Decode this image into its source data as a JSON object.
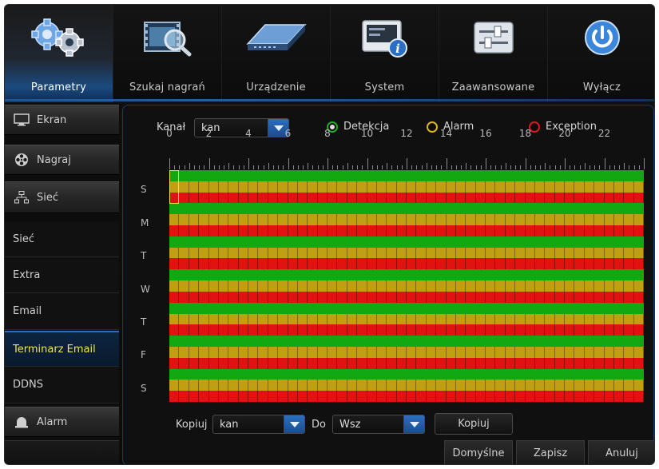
{
  "nav": {
    "items": [
      {
        "label": "Parametry",
        "icon": "gears-icon",
        "active": true
      },
      {
        "label": "Szukaj nagrań",
        "icon": "film-search-icon",
        "active": false
      },
      {
        "label": "Urządzenie",
        "icon": "hard-drive-icon",
        "active": false
      },
      {
        "label": "System",
        "icon": "system-info-icon",
        "active": false
      },
      {
        "label": "Zaawansowane",
        "icon": "sliders-icon",
        "active": false
      },
      {
        "label": "Wyłącz",
        "icon": "power-icon",
        "active": false
      }
    ]
  },
  "sidebar": {
    "items": [
      {
        "label": "Ekran",
        "icon": "monitor-icon",
        "kind": "category"
      },
      {
        "label": "Nagraj",
        "icon": "film-reel-icon",
        "kind": "category"
      },
      {
        "label": "Sieć",
        "icon": "network-icon",
        "kind": "category"
      },
      {
        "label": "Sieć",
        "kind": "sub"
      },
      {
        "label": "Extra",
        "kind": "sub"
      },
      {
        "label": "Email",
        "kind": "sub"
      },
      {
        "label": "Terminarz Email",
        "kind": "sub",
        "selected": true
      },
      {
        "label": "DDNS",
        "kind": "sub"
      },
      {
        "label": "Alarm",
        "icon": "alarm-bell-icon",
        "kind": "category"
      }
    ]
  },
  "schedule": {
    "channel_label": "Kanał",
    "channel_value": "kan",
    "legend": [
      {
        "label": "Detekcja",
        "color": "#1fae1f",
        "checked": true
      },
      {
        "label": "Alarm",
        "color": "#e1b51a",
        "checked": false
      },
      {
        "label": "Exception",
        "color": "#e01818",
        "checked": false
      }
    ],
    "hours": [
      "0",
      "2",
      "4",
      "6",
      "8",
      "10",
      "12",
      "14",
      "16",
      "18",
      "20",
      "22"
    ],
    "days": [
      "S",
      "M",
      "T",
      "W",
      "T",
      "F",
      "S"
    ],
    "colors": {
      "detection": "#12a812",
      "alarm": "#c0a012",
      "exception": "#e01212"
    },
    "copy_label": "Kopiuj",
    "copy_from_value": "kan",
    "to_label": "Do",
    "copy_to_value": "Wsz",
    "copy_button": "Kopiuj"
  },
  "footer": {
    "default_button": "Domyślne",
    "save_button": "Zapisz",
    "cancel_button": "Anuluj"
  }
}
